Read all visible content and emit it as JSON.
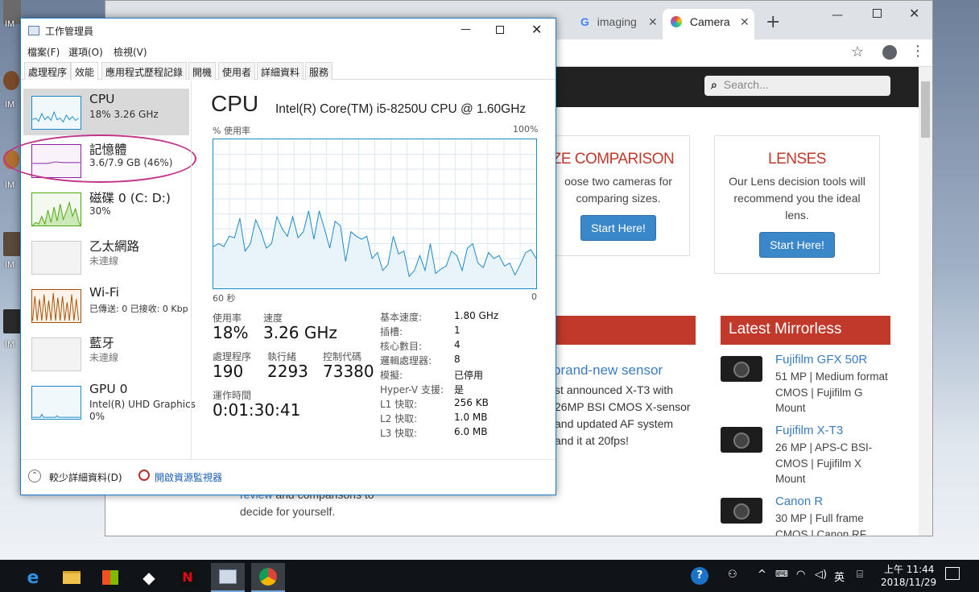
{
  "desktop": {
    "icon_labels": [
      "IM",
      "IM",
      "IM",
      "IM",
      "IM"
    ]
  },
  "browser": {
    "tabs": [
      {
        "label": "imaging",
        "icon": "google-g-icon"
      },
      {
        "label": "Camera",
        "icon": "camera-site-icon"
      }
    ],
    "new_tab_label": "+",
    "site": {
      "search_placeholder": "Search...",
      "size_card": {
        "title": "SIZE COMPARISON",
        "text": "oose two cameras for comparing sizes.",
        "button": "Start Here!"
      },
      "lens_card": {
        "title": "LENSES",
        "text": "Our Lens decision tools will recommend you the ideal lens.",
        "button": "Start Here!"
      },
      "latest_mirrorless": "Latest Mirrorless",
      "article_title": "brand-new sensor",
      "article_text": "st announced X-T3 with 26MP BSI CMOS X-sensor and updated AF system and it at 20fps!",
      "review_link": "review",
      "review_text": "and comparisons to",
      "decide_text": "decide for yourself.",
      "mirrorless": [
        {
          "name": "Fujifilm GFX 50R",
          "desc": "51 MP | Medium format CMOS | Fujifilm G Mount"
        },
        {
          "name": "Fujifilm X-T3",
          "desc": "26 MP | APS-C BSI-CMOS | Fujifilm X Mount"
        },
        {
          "name": "Canon R",
          "desc": "30 MP | Full frame CMOS | Canon RF"
        }
      ]
    }
  },
  "taskmgr": {
    "title": "工作管理員",
    "menu": [
      "檔案(F)",
      "選項(O)",
      "檢視(V)"
    ],
    "tabs": [
      "處理程序",
      "效能",
      "應用程式歷程記錄",
      "開機",
      "使用者",
      "詳細資料",
      "服務"
    ],
    "active_tab_index": 1,
    "perf_items": [
      {
        "name": "CPU",
        "sub": "18% 3.26 GHz",
        "color": "#1c8ac7"
      },
      {
        "name": "記憶體",
        "sub": "3.6/7.9 GB (46%)",
        "color": "#8b1fa5"
      },
      {
        "name": "磁碟 0 (C: D:)",
        "sub": "30%",
        "color": "#4da60c"
      },
      {
        "name": "乙太網路",
        "sub": "未連線",
        "color": "#aaaaaa"
      },
      {
        "name": "Wi-Fi",
        "sub": "已傳送: 0 已接收: 0 Kbp",
        "color": "#a74f01"
      },
      {
        "name": "藍牙",
        "sub": "未連線",
        "color": "#aaaaaa"
      },
      {
        "name": "GPU 0",
        "sub": "Intel(R) UHD Graphics",
        "sub2": "0%",
        "color": "#1c8ac7"
      }
    ],
    "cpu": {
      "heading": "CPU",
      "model": "Intel(R) Core(TM) i5-8250U CPU @ 1.60GHz",
      "usage_label": "% 使用率",
      "max_label": "100%",
      "time_left": "60 秒",
      "time_right": "0",
      "history": [
        28,
        30,
        28,
        35,
        34,
        47,
        25,
        30,
        46,
        38,
        27,
        30,
        48,
        40,
        35,
        48,
        34,
        38,
        52,
        33,
        52,
        40,
        27,
        45,
        42,
        18,
        38,
        35,
        33,
        35,
        20,
        24,
        12,
        16,
        35,
        23,
        25,
        8,
        12,
        22,
        12,
        30,
        10,
        13,
        15,
        25,
        22,
        12,
        27,
        30,
        17,
        14,
        24,
        20,
        22,
        15,
        17,
        9,
        16,
        24,
        26,
        20
      ],
      "stats": {
        "usage_label": "使用率",
        "usage": "18%",
        "speed_label": "速度",
        "speed": "3.26 GHz",
        "proc_label": "處理程序",
        "proc": "190",
        "threads_label": "執行緒",
        "threads": "2293",
        "handles_label": "控制代碼",
        "handles": "73380",
        "uptime_label": "運作時間",
        "uptime": "0:01:30:41"
      },
      "specs": [
        {
          "label": "基本速度:",
          "value": "1.80 GHz"
        },
        {
          "label": "插槽:",
          "value": "1"
        },
        {
          "label": "核心數目:",
          "value": "4"
        },
        {
          "label": "邏輯處理器:",
          "value": "8"
        },
        {
          "label": "模擬:",
          "value": "已停用"
        },
        {
          "label": "Hyper-V 支援:",
          "value": "是"
        },
        {
          "label": "L1 快取:",
          "value": "256 KB"
        },
        {
          "label": "L2 快取:",
          "value": "1.0 MB"
        },
        {
          "label": "L3 快取:",
          "value": "6.0 MB"
        }
      ]
    },
    "footer": {
      "less_details": "較少詳細資料(D)",
      "resource_monitor": "開啟資源監視器"
    }
  },
  "taskbar": {
    "time": "上午 11:44",
    "date": "2018/11/29",
    "ime": "英"
  }
}
